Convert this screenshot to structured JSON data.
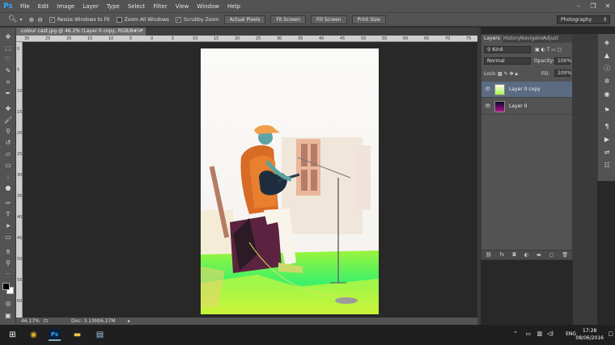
{
  "app": {
    "logo": "Ps"
  },
  "menu": [
    "File",
    "Edit",
    "Image",
    "Layer",
    "Type",
    "Select",
    "Filter",
    "View",
    "Window",
    "Help"
  ],
  "window_controls": [
    "–",
    "❐",
    "✕"
  ],
  "options": {
    "tool_icon": "zoom-icon",
    "checks": [
      {
        "label": "Resize Windows to Fit",
        "checked": true
      },
      {
        "label": "Zoom All Windows",
        "checked": false
      },
      {
        "label": "Scrubby Zoom",
        "checked": true
      }
    ],
    "buttons": [
      "Actual Pixels",
      "Fit Screen",
      "Fill Screen",
      "Print Size"
    ],
    "workspace": "Photography"
  },
  "document": {
    "tab_title": "colour cast.jpg @ 46.2% (Layer 0 copy, RGB/8#) *",
    "tab_close": "×",
    "zoom": "46.17%",
    "doc_size": "Doc: 3.13M/6.27M"
  },
  "ruler_labels": [
    "30",
    "25",
    "20",
    "15",
    "10",
    "5",
    "0",
    "5",
    "10",
    "15",
    "20",
    "25",
    "30",
    "35",
    "40",
    "45",
    "50",
    "55",
    "60",
    "65",
    "70",
    "75"
  ],
  "panel": {
    "tabs": [
      "Layers",
      "History",
      "Navigator",
      "Adjust"
    ],
    "filter_kind": "Kind",
    "blend_mode": "Normal",
    "opacity_label": "Opacity:",
    "opacity": "100%",
    "lock_label": "Lock:",
    "fill_label": "Fill:",
    "fill": "100%",
    "layers": [
      {
        "name": "Layer 0 copy",
        "selected": true
      },
      {
        "name": "Layer 0",
        "selected": false
      }
    ],
    "footer_icons": [
      "link-icon",
      "fx",
      "mask-icon",
      "adjustment-icon",
      "folder-icon",
      "new-layer-icon",
      "trash-icon"
    ]
  },
  "taskbar": {
    "lang": "ENG",
    "time": "17:28",
    "date": "08/06/2016"
  },
  "colors": {
    "accent": "#31a8ff",
    "selected_layer": "#5a6b82"
  }
}
